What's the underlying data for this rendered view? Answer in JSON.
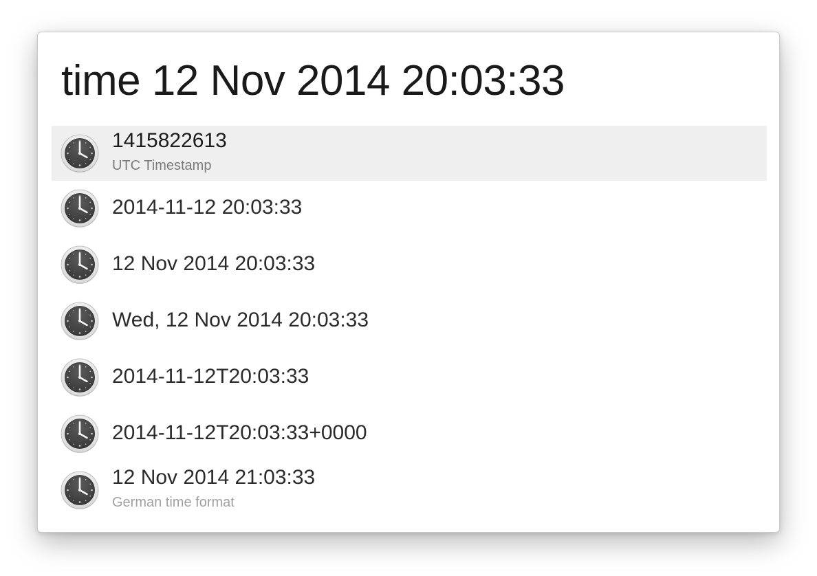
{
  "search": {
    "query": "time 12 Nov 2014 20:03:33"
  },
  "colors": {
    "selected_row": "#efefef",
    "clock_face": "#3a3a3a",
    "clock_rim": "#d8d8d8"
  },
  "results": [
    {
      "title": "1415822613",
      "subtitle": "UTC Timestamp",
      "icon": "clock-icon",
      "selected": true
    },
    {
      "title": "2014-11-12 20:03:33",
      "subtitle": "",
      "icon": "clock-icon",
      "selected": false
    },
    {
      "title": "12 Nov 2014 20:03:33",
      "subtitle": "",
      "icon": "clock-icon",
      "selected": false
    },
    {
      "title": "Wed, 12 Nov 2014 20:03:33",
      "subtitle": "",
      "icon": "clock-icon",
      "selected": false
    },
    {
      "title": "2014-11-12T20:03:33",
      "subtitle": "",
      "icon": "clock-icon",
      "selected": false
    },
    {
      "title": "2014-11-12T20:03:33+0000",
      "subtitle": "",
      "icon": "clock-icon",
      "selected": false
    },
    {
      "title": "12 Nov 2014 21:03:33",
      "subtitle": "German time format",
      "icon": "clock-icon",
      "selected": false
    }
  ]
}
